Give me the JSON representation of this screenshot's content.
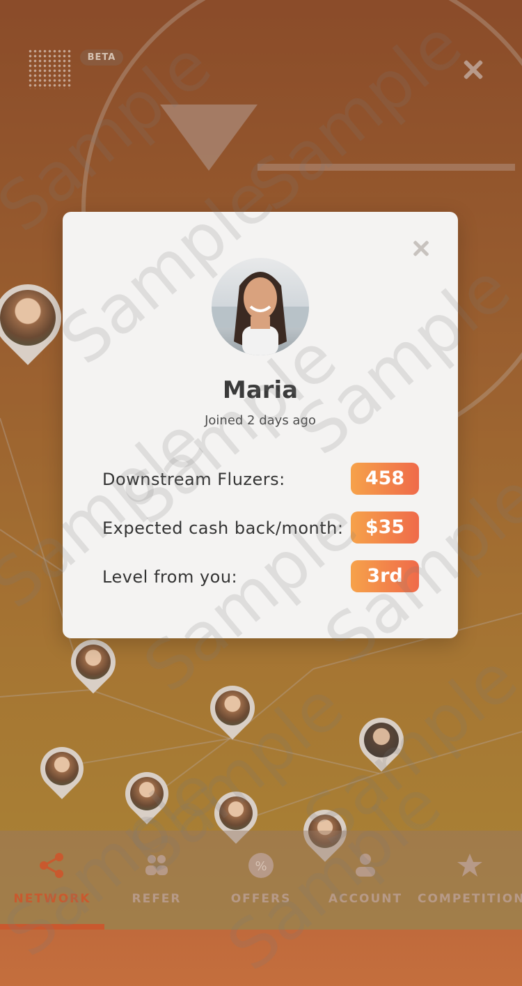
{
  "header": {
    "beta_label": "BETA"
  },
  "profile": {
    "name": "Maria",
    "joined": "Joined 2 days ago"
  },
  "stats": [
    {
      "label": "Downstream Fluzers:",
      "value": "458"
    },
    {
      "label": "Expected cash back/month:",
      "value": "$35"
    },
    {
      "label": "Level from you:",
      "value": "3rd"
    }
  ],
  "tabs": [
    {
      "label": "NETWORK",
      "icon": "share-icon",
      "active": true
    },
    {
      "label": "REFER",
      "icon": "people-icon",
      "active": false
    },
    {
      "label": "OFFERS",
      "icon": "percent-badge-icon",
      "active": false
    },
    {
      "label": "ACCOUNT",
      "icon": "person-icon",
      "active": false
    },
    {
      "label": "COMPETITION",
      "icon": "star-icon",
      "active": false
    }
  ],
  "watermark": "Sample",
  "colors": {
    "accent": "#c9592e",
    "pill_start": "#f6a24a",
    "pill_end": "#ef6a4a"
  }
}
